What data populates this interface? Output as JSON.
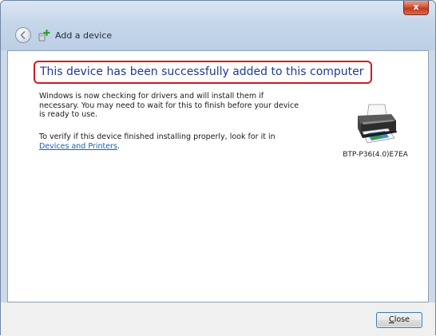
{
  "window": {
    "title": "Add a device",
    "close_glyph": "x"
  },
  "main": {
    "headline": "This device has been successfully added to this computer",
    "paragraph1": "Windows is now checking for drivers and will install them if necessary. You may need to wait for this to finish before your device is ready to use.",
    "paragraph2_text": "To verify if this device finished installing properly, look for it in",
    "paragraph2_link": "Devices and Printers",
    "paragraph2_end": ".",
    "device_name": "BTP-P36(4.0)E7EA",
    "device_icon": "printer-icon"
  },
  "footer": {
    "close_button_accel": "C",
    "close_button_rest": "lose"
  },
  "colors": {
    "headline_text": "#1f3a93",
    "highlight_border": "#d01a22",
    "link": "#1460b4"
  }
}
